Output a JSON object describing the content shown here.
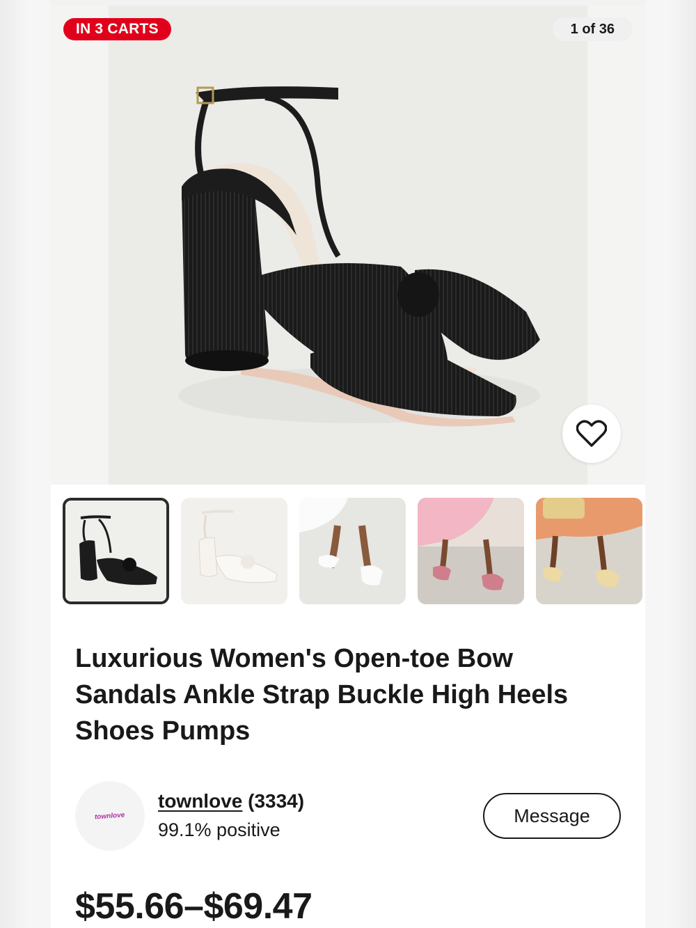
{
  "gallery": {
    "cart_badge": "IN 3 CARTS",
    "counter": "1 of 36",
    "heart_icon": "heart-outline-icon",
    "thumbnails": [
      {
        "label": "black bow sandal",
        "selected": true
      },
      {
        "label": "white bow sandal",
        "selected": false
      },
      {
        "label": "white sandals worn",
        "selected": false
      },
      {
        "label": "pink sandals worn",
        "selected": false
      },
      {
        "label": "gold sandals worn",
        "selected": false
      }
    ]
  },
  "listing": {
    "title": "Luxurious Women's Open-toe Bow Sandals Ankle Strap Buckle High Heels Shoes Pumps",
    "price": "$55.66–$69.47"
  },
  "seller": {
    "logo_text": "townlove",
    "name": "townlove",
    "feedback_count": "(3334)",
    "positive": "99.1% positive",
    "message_label": "Message"
  },
  "colors": {
    "badge_red": "#e0001b",
    "text": "#191919",
    "seller_logo": "#b32fa7"
  }
}
